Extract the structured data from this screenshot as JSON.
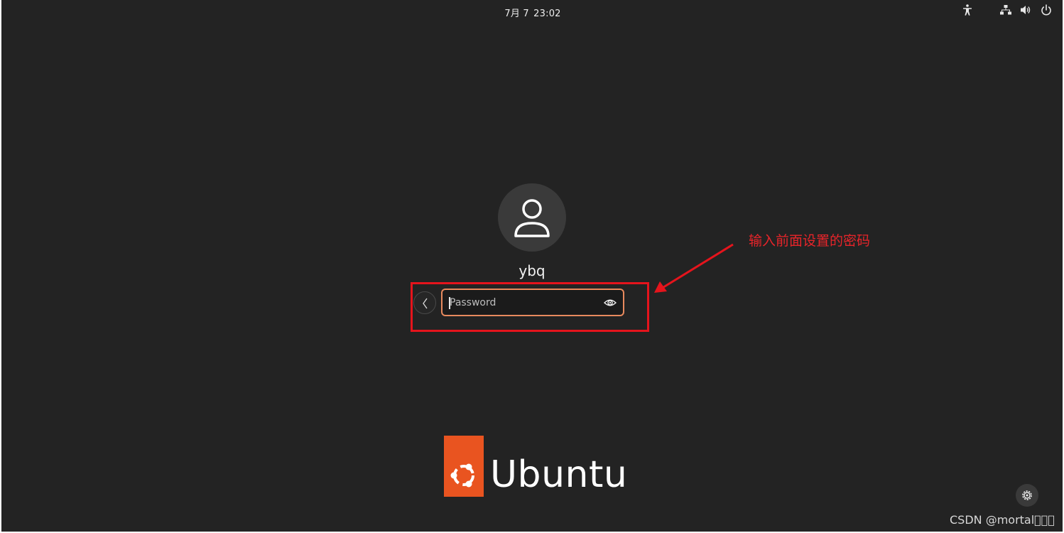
{
  "topbar": {
    "clock": "7月 7",
    "time": "23:02",
    "icons": [
      "accessibility-icon",
      "network-icon",
      "volume-icon",
      "power-icon"
    ]
  },
  "login": {
    "username": "ybq",
    "password_placeholder": "Password",
    "password_value": ""
  },
  "annotation": {
    "text": "输入前面设置的密码",
    "color": "#e5141c"
  },
  "branding": {
    "wordmark": "Ubuntu",
    "logo_color": "#e95420"
  },
  "watermark": "CSDN @mortal\u0000\u0000\u0000"
}
